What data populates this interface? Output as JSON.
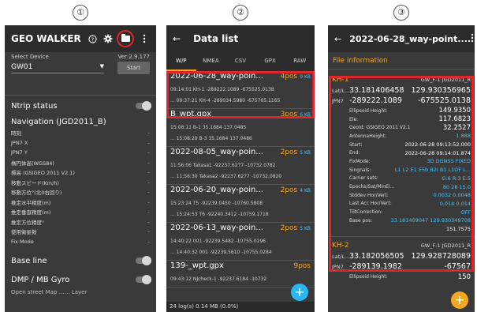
{
  "steps": [
    "①",
    "②",
    "③"
  ],
  "screen1": {
    "title": "GEO WALKER",
    "icons": [
      "help-icon",
      "gear-icon",
      "folder-icon",
      "more-icon"
    ],
    "device_label": "Select Device",
    "version": "Ver:2.9.177",
    "device_value": "GW01",
    "start_button": "Start",
    "ntrip_label": "Ntrip status",
    "nav_title": "Navigation  (JGD2011_B)",
    "nav_items": [
      "時刻",
      "JPN7 X",
      "JPN7 Y",
      "楕円体高(WGS84)",
      "標高 (GSIGEO 2011 V2.1)",
      "移動スピード(Km/h)",
      "移動方位°(北0右回り)",
      "推定水平精度(m)",
      "推定垂直精度(m)",
      "推定方位精度°",
      "使用衛星数",
      "Fix Mode"
    ],
    "nav_dash": "–",
    "baseline_label": "Base line",
    "dmp_label": "DMP / MB Gyro",
    "cutoff_text": "Open street Map ……  Layer"
  },
  "screen2": {
    "title": "Data list",
    "tabs": [
      "W/P",
      "NMEA",
      "CSV",
      "GPX",
      "RAW"
    ],
    "files": [
      {
        "name": "2022-06-28_way-poin...",
        "pos": "4pos",
        "size": "9 KB",
        "line1": "09:14:01 KH-1 -289222.1089 -675525.0138",
        "line2": "... 09:37:21 KH-4 -289034.5980 -675765.1165"
      },
      {
        "name": "B_wpt.gpx",
        "pos": "3pos",
        "size": "6 KB",
        "line1": "15:08:11 B-1 35.1684 137.0485",
        "line2": "... 15:08:29 B-3 35.1684 137.0486"
      },
      {
        "name": "2022-08-05_way-poin...",
        "pos": "2pos",
        "size": "5 KB",
        "line1": "11:56:06 Takasa1 -92237.6277 -10732.0782",
        "line2": "... 11:56:30 Takasa2 -92237.6277 -10732.0820"
      },
      {
        "name": "2022-06-20_way-poin...",
        "pos": "2pos",
        "size": "4 KB",
        "line1": "15:23:24 T5 -92239.0450 -10760.5808",
        "line2": "... 15:24:53 T6 -92240.3412 -10759.1718"
      },
      {
        "name": "2022-06-13_way-poin...",
        "pos": "2pos",
        "size": "5 KB",
        "line1": "14:40:22 001 -92239.5482 -10755.0196",
        "line2": "... 14:40:32 001 -92239.5610 -10755.0284"
      },
      {
        "name": "139-_wpt.gpx",
        "pos": "9pos",
        "size": "",
        "line1": "09:43:12 NJcheck-1 -92237.6184 -10732",
        "line2": ""
      }
    ],
    "footer": "24 log(s) 0.14 MB  (0.0%)",
    "fab": "+"
  },
  "screen3": {
    "title": "2022-06-28_way-point....",
    "section": "File information",
    "point1": {
      "name": "KH-1",
      "meta": "GW_F-1  JGD2011_R",
      "lat_label": "Lat/L...",
      "lat": "33.181406458",
      "lon": "129.930356965",
      "jpn_label": "JPN7",
      "x": "-289222.1089",
      "y": "-675525.0138",
      "attrs": [
        {
          "label": "Ellipsoid Height:",
          "value": "149.9350",
          "style": "big"
        },
        {
          "label": "Ele:",
          "value": "117.6823",
          "style": "big"
        },
        {
          "label": "Geoid: GSIGEO 2011 V2.1",
          "value": "32.2527",
          "style": "big"
        },
        {
          "label": "AntennaHeight:",
          "value": "1.888",
          "style": "blue"
        },
        {
          "label": "Start:",
          "value": "2022-06-28  09:13:52.000",
          "style": "small"
        },
        {
          "label": "End:",
          "value": "2022-06-28  09:14:01.874",
          "style": "small"
        },
        {
          "label": "FixMode:",
          "value": "3D DGNSS FIXED",
          "style": "blue"
        },
        {
          "label": "Singnals:",
          "value": "L1 L2 E1 E5b B2I B1 L1OF L...",
          "style": "blue"
        },
        {
          "label": "Carrier sats:",
          "value": "G:6 R:3 E:5",
          "style": "blue"
        },
        {
          "label": "Epochs/Sat/MinEl...",
          "value": "80      28      15.0",
          "style": "blue"
        },
        {
          "label": "Stddev Hor/Vert:",
          "value": "0.0032     0.0048",
          "style": "blue"
        },
        {
          "label": "Last Acc Hor/Vert:",
          "value": "0.014      0.014",
          "style": "blue"
        },
        {
          "label": "TiltCorrection:",
          "value": "OFF",
          "style": "blue"
        },
        {
          "label": "Base pos:",
          "value": "33.181409047 129.930349708",
          "style": "blue"
        }
      ],
      "base_tail": "151.7575"
    },
    "point2": {
      "name": "KH-2",
      "meta": "GW_F-1  JGD2011_R",
      "lat_label": "Lat/L...",
      "lat": "33.182056505",
      "lon": "129.928728089",
      "jpn_label": "JPN7",
      "x": "-289139.1982",
      "y": "-67567",
      "eh_label": "Ellipsoid Height:",
      "eh_value": "150"
    },
    "fab": "+"
  },
  "colors": {
    "accent": "#f5a623",
    "highlight": "#e0252b",
    "link": "#4fc3f7"
  }
}
